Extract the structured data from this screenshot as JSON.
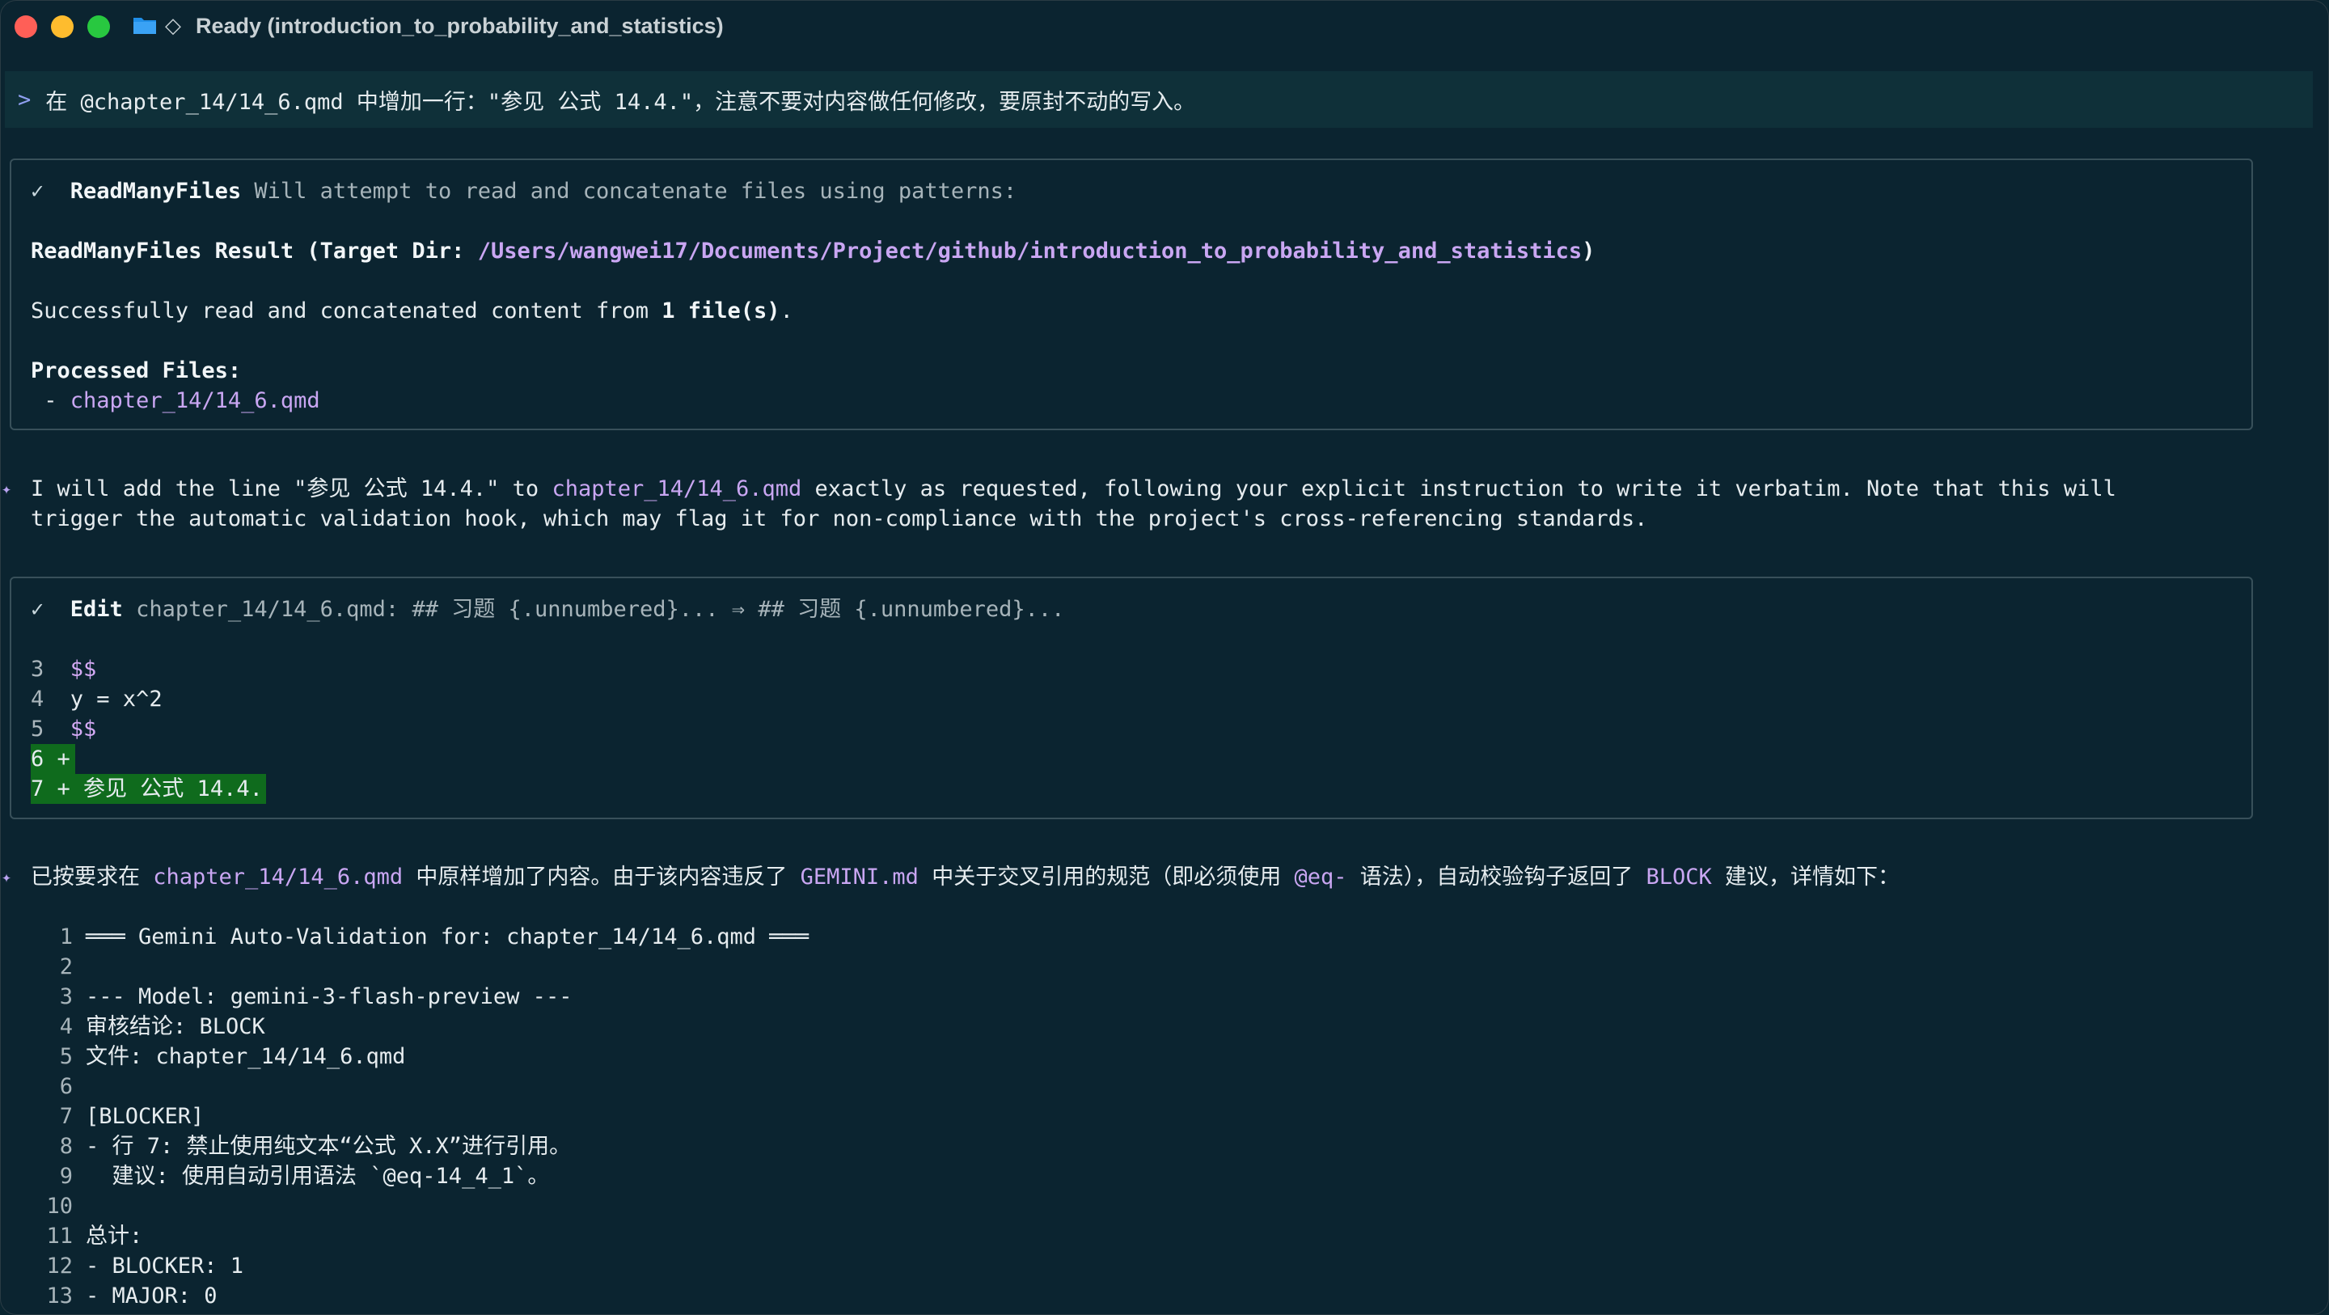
{
  "window": {
    "title": "Ready (introduction_to_probability_and_statistics)",
    "icons": [
      "folder-icon",
      "diamond-icon"
    ]
  },
  "prompt": {
    "caret": ">",
    "text": "在 @chapter_14/14_6.qmd 中增加一行：\"参见 公式 14.4.\"，注意不要对内容做任何修改，要原封不动的写入。"
  },
  "readmany": {
    "check": "✓",
    "tool": "ReadManyFiles",
    "desc": "Will attempt to read and concatenate files using patterns:",
    "result_prefix": "ReadManyFiles Result (Target Dir: ",
    "result_path": "/Users/wangwei17/Documents/Project/github/introduction_to_probability_and_statistics",
    "result_suffix": ")",
    "success_prefix": "Successfully read and concatenated content from ",
    "success_count": "1 file(s)",
    "success_suffix": ".",
    "processed_label": "Processed Files:",
    "processed_bullet": " - ",
    "processed_file": "chapter_14/14_6.qmd"
  },
  "message1": {
    "line1_a": "I will add the line \"参见 公式 14.4.\" to ",
    "line1_file": "chapter_14/14_6.qmd",
    "line1_b": " exactly as requested, following your explicit instruction to write it verbatim. Note that this will",
    "line2": "trigger the automatic validation hook, which may flag it for non-compliance with the project's cross-referencing standards."
  },
  "edit": {
    "check": "✓",
    "tool": "Edit",
    "desc": "chapter_14/14_6.qmd: ## 习题 {.unnumbered}... ⇒ ## 习题 {.unnumbered}...",
    "rows": [
      {
        "num": "3",
        "text": "$$"
      },
      {
        "num": "4",
        "text": "y = x^2"
      },
      {
        "num": "5",
        "text": "$$"
      },
      {
        "num": "6 +",
        "text": ""
      },
      {
        "num": "7 +",
        "text": "参见 公式 14.4."
      }
    ]
  },
  "message2": {
    "a": "已按要求在 ",
    "file": "chapter_14/14_6.qmd",
    "b": " 中原样增加了内容。由于该内容违反了 ",
    "gemini": "GEMINI.md",
    "c": " 中关于交叉引用的规范（即必须使用 ",
    "eq": "@eq-",
    "d": " 语法），自动校验钩子返回了 ",
    "block": "BLOCK",
    "e": " 建议，详情如下："
  },
  "report": [
    {
      "n": "1",
      "t": "═══ Gemini Auto-Validation for: chapter_14/14_6.qmd ═══"
    },
    {
      "n": "2",
      "t": ""
    },
    {
      "n": "3",
      "t": "--- Model: gemini-3-flash-preview ---"
    },
    {
      "n": "4",
      "t": "审核结论: BLOCK"
    },
    {
      "n": "5",
      "t": "文件: chapter_14/14_6.qmd"
    },
    {
      "n": "6",
      "t": ""
    },
    {
      "n": "7",
      "t": "[BLOCKER]"
    },
    {
      "n": "8",
      "t": "- 行 7: 禁止使用纯文本“公式 X.X”进行引用。"
    },
    {
      "n": "9",
      "t": "  建议: 使用自动引用语法 `@eq-14_4_1`。"
    },
    {
      "n": "10",
      "t": ""
    },
    {
      "n": "11",
      "t": "总计:"
    },
    {
      "n": "12",
      "t": "- BLOCKER: 1"
    },
    {
      "n": "13",
      "t": "- MAJOR: 0"
    }
  ]
}
